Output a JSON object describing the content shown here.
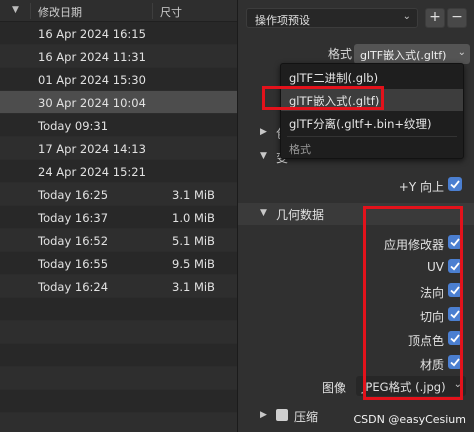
{
  "file_list": {
    "header": {
      "date": "修改日期",
      "size": "尺寸"
    },
    "rows": [
      {
        "date": "16 Apr 2024 16:15",
        "size": ""
      },
      {
        "date": "16 Apr 2024 11:31",
        "size": ""
      },
      {
        "date": "01 Apr 2024 15:30",
        "size": ""
      },
      {
        "date": "30 Apr 2024 10:04",
        "size": ""
      },
      {
        "date": "Today 09:31",
        "size": ""
      },
      {
        "date": "17 Apr 2024 14:13",
        "size": ""
      },
      {
        "date": "24 Apr 2024 15:21",
        "size": ""
      },
      {
        "date": "Today 16:25",
        "size": "3.1 MiB"
      },
      {
        "date": "Today 16:37",
        "size": "1.0 MiB"
      },
      {
        "date": "Today 16:52",
        "size": "5.1 MiB"
      },
      {
        "date": "Today 16:55",
        "size": "9.5 MiB"
      },
      {
        "date": "Today 16:24",
        "size": "3.1 MiB"
      }
    ]
  },
  "settings": {
    "preset": "操作项预设",
    "add_label": "+",
    "remove_label": "−",
    "format_label": "格式",
    "format_value": "glTF嵌入式(.gltf)",
    "format_popup": {
      "items": [
        "glTF二进制(.glb)",
        "glTF嵌入式(.gltf)",
        "glTF分离(.gltf+.bin+纹理)"
      ],
      "heading": "格式"
    },
    "collapsed_1": "包",
    "collapsed_2": "变",
    "yup_label": "+Y 向上",
    "geometry_title": "几何数据",
    "geometry_options": [
      "应用修改器",
      "UV",
      "法向",
      "切向",
      "顶点色",
      "材质"
    ],
    "image_label": "图像",
    "image_value": "JPEG格式 (.jpg)",
    "compression_title": "压缩"
  },
  "watermark": "CSDN @easyCesium",
  "colors": {
    "accent": "#4b7fd1",
    "annotation_red": "#e3121b"
  }
}
